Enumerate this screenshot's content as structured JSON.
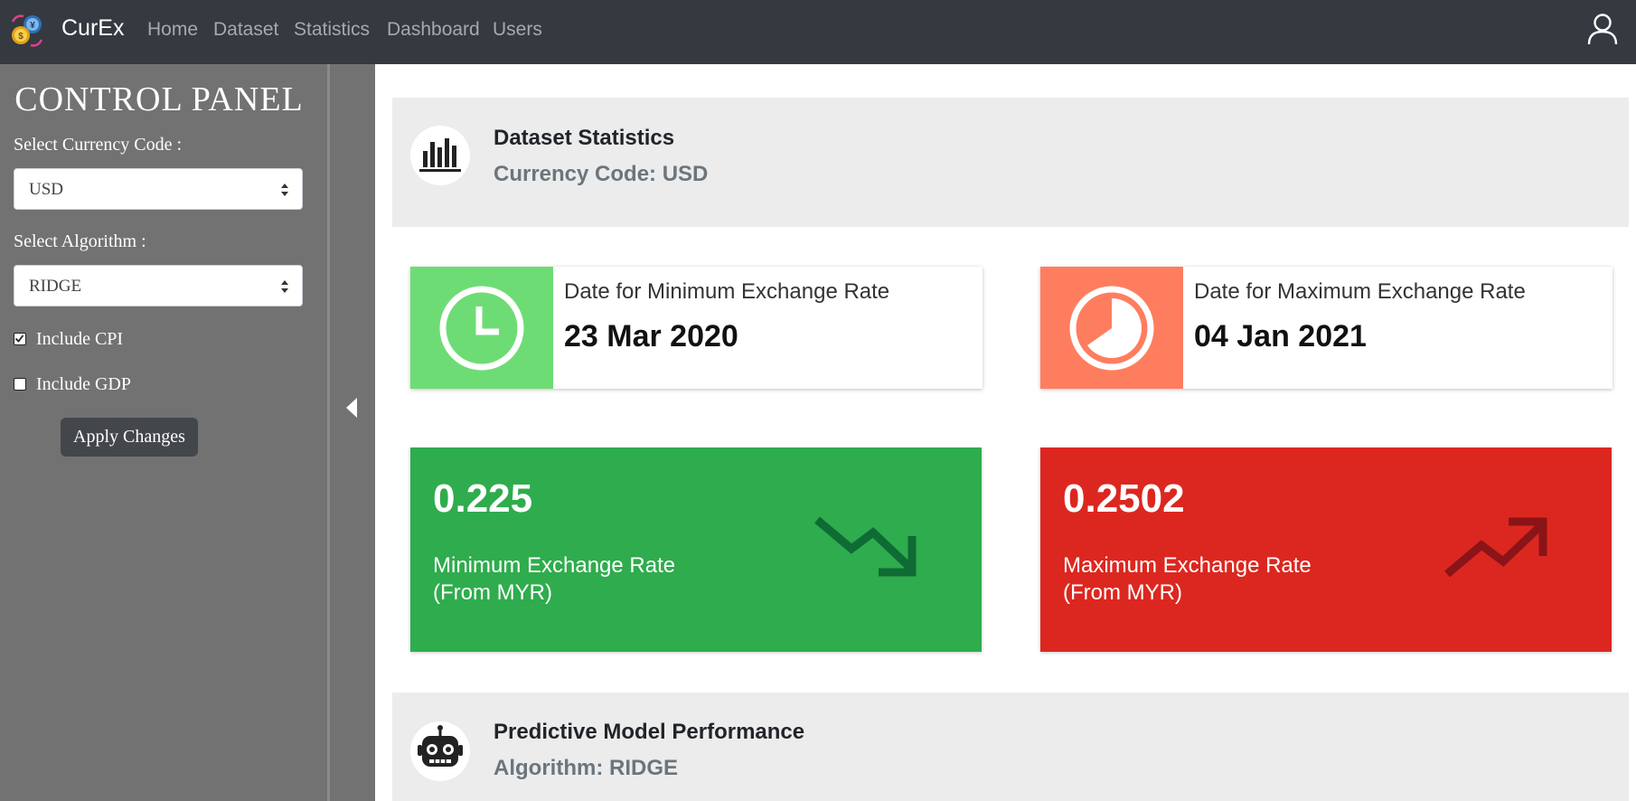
{
  "app": {
    "brand": "CurEx"
  },
  "nav": {
    "items": [
      {
        "label": "Home"
      },
      {
        "label": "Dataset"
      },
      {
        "label": "Statistics"
      },
      {
        "label": "Dashboard"
      },
      {
        "label": "Users"
      }
    ]
  },
  "control_panel": {
    "title": "CONTROL PANEL",
    "currency_label": "Select Currency Code :",
    "currency_value": "USD",
    "algorithm_label": "Select Algorithm :",
    "algorithm_value": "RIDGE",
    "include_cpi": {
      "label": "Include CPI",
      "checked": true
    },
    "include_gdp": {
      "label": "Include GDP",
      "checked": false
    },
    "apply_label": "Apply Changes"
  },
  "dataset_stats": {
    "title": "Dataset Statistics",
    "subtitle": "Currency Code: USD"
  },
  "min_date_card": {
    "title": "Date for Minimum Exchange Rate",
    "value": "23 Mar 2020",
    "color": "#6edc74"
  },
  "max_date_card": {
    "title": "Date for Maximum Exchange Rate",
    "value": "04 Jan 2021",
    "color": "#ff7d5f"
  },
  "min_rate_box": {
    "value": "0.225",
    "label_line1": "Minimum Exchange Rate",
    "label_line2": "(From MYR)",
    "color": "#2fac4d",
    "icon": "trending-down-icon"
  },
  "max_rate_box": {
    "value": "0.2502",
    "label_line1": "Maximum Exchange Rate",
    "label_line2": "(From MYR)",
    "color": "#dc2720",
    "icon": "trending-up-icon"
  },
  "model_perf": {
    "title": "Predictive Model Performance",
    "subtitle": "Algorithm: RIDGE"
  }
}
